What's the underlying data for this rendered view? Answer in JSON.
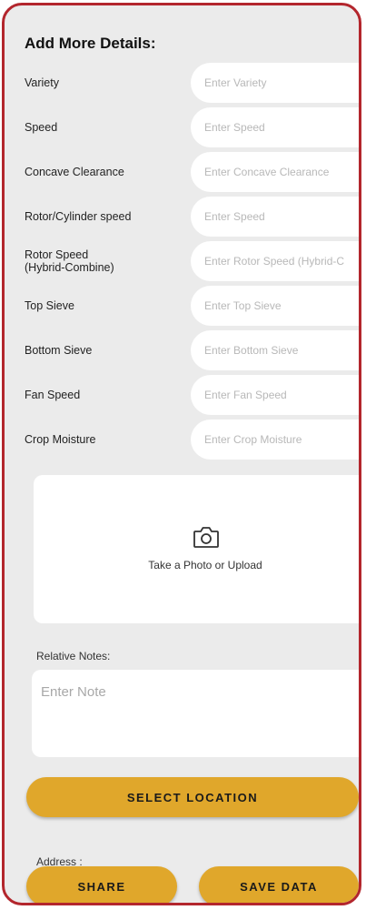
{
  "heading": "Add More Details:",
  "fields": [
    {
      "label": "Variety",
      "placeholder": "Enter Variety"
    },
    {
      "label": "Speed",
      "placeholder": "Enter Speed"
    },
    {
      "label": "Concave Clearance",
      "placeholder": "Enter Concave Clearance"
    },
    {
      "label": "Rotor/Cylinder speed",
      "placeholder": "Enter Speed"
    },
    {
      "label": "Rotor Speed\n(Hybrid-Combine)",
      "placeholder": "Enter Rotor Speed (Hybrid-C"
    },
    {
      "label": "Top Sieve",
      "placeholder": "Enter Top Sieve"
    },
    {
      "label": "Bottom Sieve",
      "placeholder": "Enter Bottom Sieve"
    },
    {
      "label": "Fan Speed",
      "placeholder": "Enter Fan Speed"
    },
    {
      "label": "Crop Moisture",
      "placeholder": "Enter Crop Moisture"
    }
  ],
  "upload": {
    "text": "Take a Photo or Upload",
    "icon": "camera-icon"
  },
  "notes": {
    "label": "Relative Notes:",
    "placeholder": "Enter Note"
  },
  "buttons": {
    "select_location": "SELECT LOCATION",
    "share": "SHARE",
    "save_data": "SAVE DATA"
  },
  "address_label": "Address :",
  "colors": {
    "accent": "#e0a72b",
    "border": "#b3262d",
    "panel_bg": "#ebebeb"
  }
}
